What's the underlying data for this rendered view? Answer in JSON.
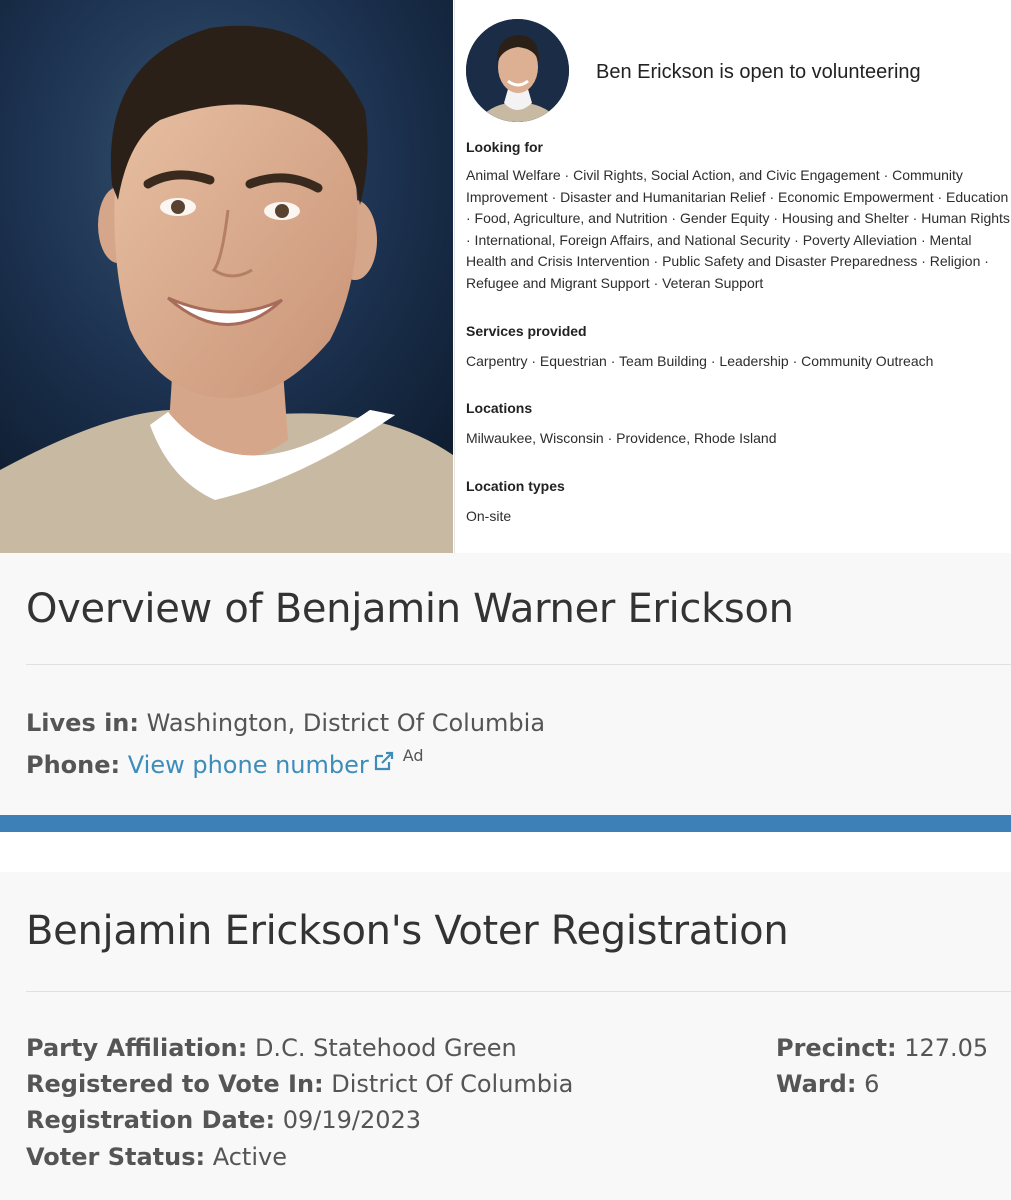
{
  "volunteer_card": {
    "headline": "Ben Erickson is open to volunteering",
    "sections": [
      {
        "label": "Looking for",
        "text": "Animal Welfare · Civil Rights, Social Action, and Civic Engagement · Community Improvement · Disaster and Humanitarian Relief · Economic Empowerment · Education · Food, Agriculture, and Nutrition · Gender Equity · Housing and Shelter · Human Rights · International, Foreign Affairs, and National Security · Poverty Alleviation · Mental Health and Crisis Intervention · Public Safety and Disaster Preparedness · Religion · Refugee and Migrant Support · Veteran Support"
      },
      {
        "label": "Services provided",
        "text": "Carpentry · Equestrian · Team Building · Leadership · Community Outreach"
      },
      {
        "label": "Locations",
        "text": "Milwaukee, Wisconsin · Providence, Rhode Island"
      },
      {
        "label": "Location types",
        "text": "On-site"
      }
    ]
  },
  "overview": {
    "title": "Overview of Benjamin Warner Erickson",
    "lives_in_label": "Lives in:",
    "lives_in_value": "Washington, District Of Columbia",
    "phone_label": "Phone:",
    "phone_link": "View phone number",
    "ad_label": "Ad",
    "link_color": "#3d8dbb"
  },
  "voter": {
    "title": "Benjamin Erickson's Voter Registration",
    "party_label": "Party Affiliation:",
    "party_value": "D.C. Statehood Green",
    "registered_label": "Registered to Vote In:",
    "registered_value": "District Of Columbia",
    "date_label": "Registration Date:",
    "date_value": "09/19/2023",
    "status_label": "Voter Status:",
    "status_value": "Active",
    "precinct_label": "Precinct:",
    "precinct_value": "127.05",
    "ward_label": "Ward:",
    "ward_value": "6"
  },
  "colors": {
    "accent_band": "#3d80b7",
    "panel_bg": "#f8f8f8"
  }
}
